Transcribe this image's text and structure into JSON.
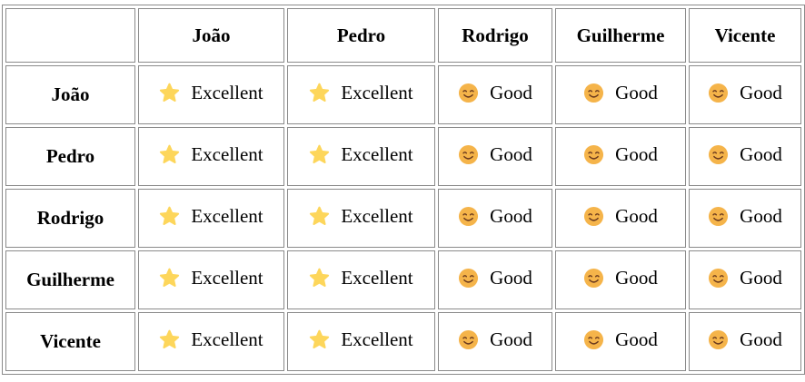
{
  "columns": [
    "João",
    "Pedro",
    "Rodrigo",
    "Guilherme",
    "Vicente"
  ],
  "rows": [
    {
      "name": "João",
      "cells": [
        {
          "icon": "star-icon",
          "label": "Excellent"
        },
        {
          "icon": "star-icon",
          "label": "Excellent"
        },
        {
          "icon": "smile-icon",
          "label": "Good"
        },
        {
          "icon": "smile-icon",
          "label": "Good"
        },
        {
          "icon": "smile-icon",
          "label": "Good"
        }
      ]
    },
    {
      "name": "Pedro",
      "cells": [
        {
          "icon": "star-icon",
          "label": "Excellent"
        },
        {
          "icon": "star-icon",
          "label": "Excellent"
        },
        {
          "icon": "smile-icon",
          "label": "Good"
        },
        {
          "icon": "smile-icon",
          "label": "Good"
        },
        {
          "icon": "smile-icon",
          "label": "Good"
        }
      ]
    },
    {
      "name": "Rodrigo",
      "cells": [
        {
          "icon": "star-icon",
          "label": "Excellent"
        },
        {
          "icon": "star-icon",
          "label": "Excellent"
        },
        {
          "icon": "smile-icon",
          "label": "Good"
        },
        {
          "icon": "smile-icon",
          "label": "Good"
        },
        {
          "icon": "smile-icon",
          "label": "Good"
        }
      ]
    },
    {
      "name": "Guilherme",
      "cells": [
        {
          "icon": "star-icon",
          "label": "Excellent"
        },
        {
          "icon": "star-icon",
          "label": "Excellent"
        },
        {
          "icon": "smile-icon",
          "label": "Good"
        },
        {
          "icon": "smile-icon",
          "label": "Good"
        },
        {
          "icon": "smile-icon",
          "label": "Good"
        }
      ]
    },
    {
      "name": "Vicente",
      "cells": [
        {
          "icon": "star-icon",
          "label": "Excellent"
        },
        {
          "icon": "star-icon",
          "label": "Excellent"
        },
        {
          "icon": "smile-icon",
          "label": "Good"
        },
        {
          "icon": "smile-icon",
          "label": "Good"
        },
        {
          "icon": "smile-icon",
          "label": "Good"
        }
      ]
    }
  ],
  "colors": {
    "star": "#FDD65B",
    "smile_face": "#F5B44A",
    "smile_features": "#6B3A1E",
    "border": "#8a8a8a"
  }
}
